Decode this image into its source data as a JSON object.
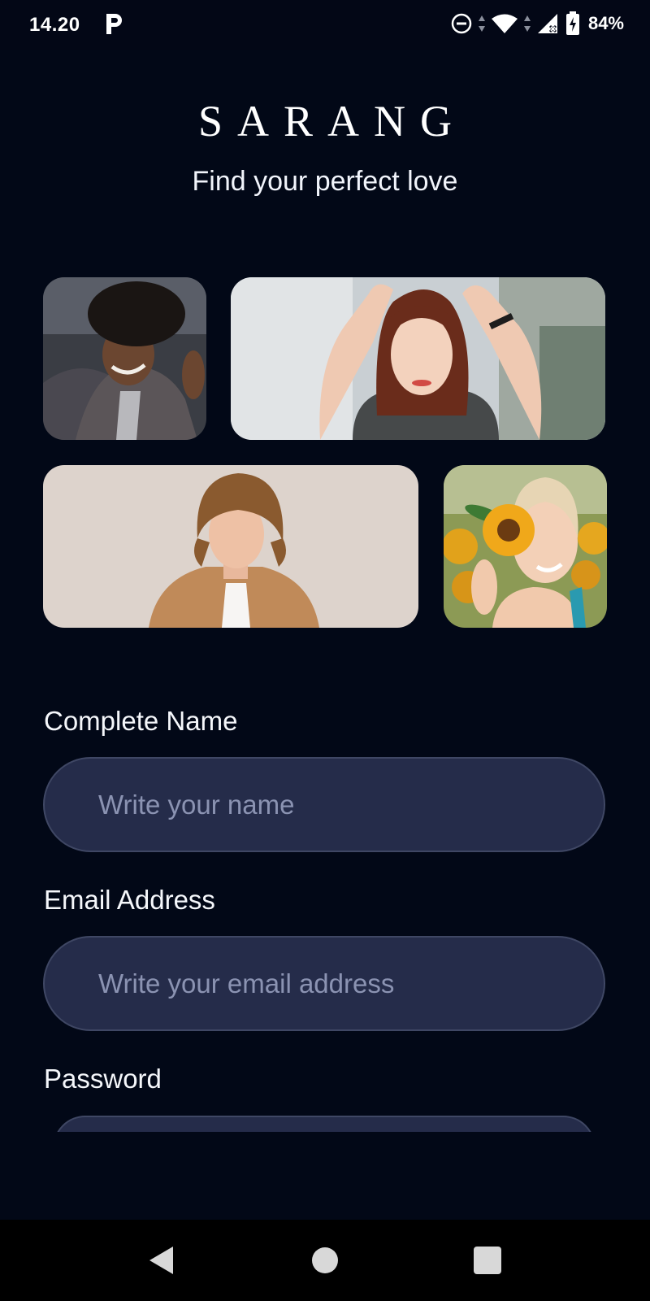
{
  "status_bar": {
    "time": "14.20",
    "battery": "84%",
    "icons": [
      "parking-app-icon",
      "do-not-disturb-icon",
      "wifi-icon",
      "signal-icon",
      "battery-icon"
    ]
  },
  "app": {
    "logo": "SARANG",
    "tagline": "Find your perfect love"
  },
  "photos": [
    {
      "name": "photo-man-curly-hair"
    },
    {
      "name": "photo-woman-hands-on-head"
    },
    {
      "name": "photo-man-tan-blazer"
    },
    {
      "name": "photo-woman-sunflower"
    }
  ],
  "form": {
    "name_label": "Complete Name",
    "name_placeholder": "Write your name",
    "name_value": "",
    "email_label": "Email Address",
    "email_placeholder": "Write your email address",
    "email_value": "",
    "password_label": "Password"
  },
  "nav": {
    "icons": [
      "back-icon",
      "home-icon",
      "recents-icon"
    ]
  },
  "colors": {
    "background": "#020817",
    "field_background": "#252c4a",
    "placeholder": "#8b93b2"
  }
}
